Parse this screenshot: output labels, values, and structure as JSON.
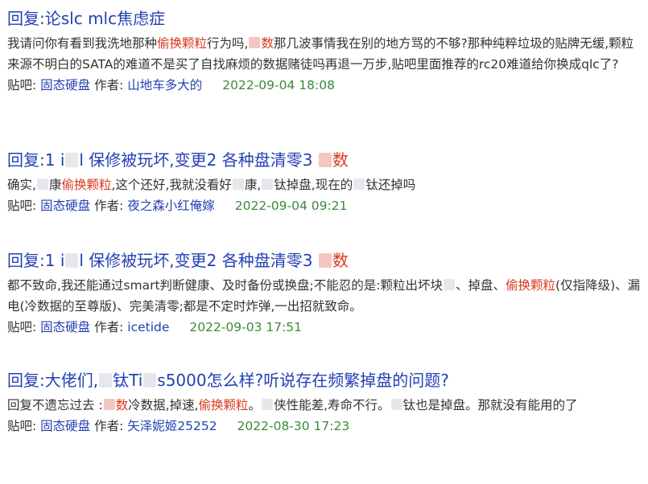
{
  "colors": {
    "title_link": "#2440b3",
    "highlight": "#d9381e",
    "date": "#3c8a3a",
    "text": "#333333"
  },
  "results": [
    {
      "title": "回复:论slc mlc焦虑症",
      "snippet": [
        {
          "t": "我请问你有看到我洗地那种"
        },
        {
          "t": "偷换颗粒",
          "hl": true
        },
        {
          "t": "行为吗,"
        },
        {
          "blur": true,
          "pink": true
        },
        {
          "t": "数",
          "hl": true
        },
        {
          "t": "那几波事情我在别的地方骂的不够?那种纯粹垃圾的贴牌无缓,颗粒来源不明白的SATA的难道不是买了自找麻烦的数据赌徒吗再退一万步,贴吧里面推荐的rc20难道给你换成qlc了?"
        }
      ],
      "forum_label": "贴吧:",
      "forum": "固态硬盘",
      "author_label": "作者:",
      "author": "山地车多大的",
      "date": "2022-09-04 18:08"
    },
    {
      "title_parts": [
        {
          "t": "回复:1 i"
        },
        {
          "blur": true
        },
        {
          "t": "l 保修被玩坏,变更2 各种盘清零3 "
        },
        {
          "blur": true,
          "pink": true
        },
        {
          "t": "数",
          "hl": true
        }
      ],
      "snippet": [
        {
          "t": "确实,"
        },
        {
          "blur": true
        },
        {
          "t": "康"
        },
        {
          "t": "偷换颗粒",
          "hl": true
        },
        {
          "t": ",这个还好,我就没看好"
        },
        {
          "blur": true
        },
        {
          "t": "康,"
        },
        {
          "blur": true
        },
        {
          "t": "钛掉盘,现在的"
        },
        {
          "blur": true
        },
        {
          "t": "钛还掉吗"
        }
      ],
      "forum_label": "贴吧:",
      "forum": "固态硬盘",
      "author_label": "作者:",
      "author": "夜之森小红俺嫁",
      "date": "2022-09-04 09:21"
    },
    {
      "title_parts": [
        {
          "t": "回复:1 i"
        },
        {
          "blur": true
        },
        {
          "t": "l 保修被玩坏,变更2 各种盘清零3 "
        },
        {
          "blur": true,
          "pink": true
        },
        {
          "t": "数",
          "hl": true
        }
      ],
      "snippet": [
        {
          "t": "都不致命,我还能通过smart判断健康、及时备份或换盘;不能忍的是:颗粒出坏块"
        },
        {
          "blur": true
        },
        {
          "t": "、掉盘、"
        },
        {
          "t": "偷换颗粒",
          "hl": true
        },
        {
          "t": "(仅指降级)、漏电(冷数据的至尊版)、完美清零;都是不定时炸弹,一出招就致命。"
        }
      ],
      "forum_label": "贴吧:",
      "forum": "固态硬盘",
      "author_label": "作者:",
      "author": "icetide",
      "date": "2022-09-03 17:51"
    },
    {
      "title_parts": [
        {
          "t": "回复:大佬们,"
        },
        {
          "blur": true
        },
        {
          "t": "钛Ti"
        },
        {
          "blur": true
        },
        {
          "t": "s5000怎么样?听说存在频繁掉盘的问题?"
        }
      ],
      "snippet": [
        {
          "t": "回复不遗忘过去 :"
        },
        {
          "blur": true,
          "pink": true
        },
        {
          "t": "数",
          "hl": true
        },
        {
          "t": "冷数据,掉速,"
        },
        {
          "t": "偷换颗粒",
          "hl": true
        },
        {
          "t": "。"
        },
        {
          "blur": true
        },
        {
          "t": "侠性能差,寿命不行。"
        },
        {
          "blur": true
        },
        {
          "t": "钛也是掉盘。那就没有能用的了"
        }
      ],
      "forum_label": "贴吧:",
      "forum": "固态硬盘",
      "author_label": "作者:",
      "author": "矢泽妮姬25252",
      "date": "2022-08-30 17:23"
    }
  ]
}
